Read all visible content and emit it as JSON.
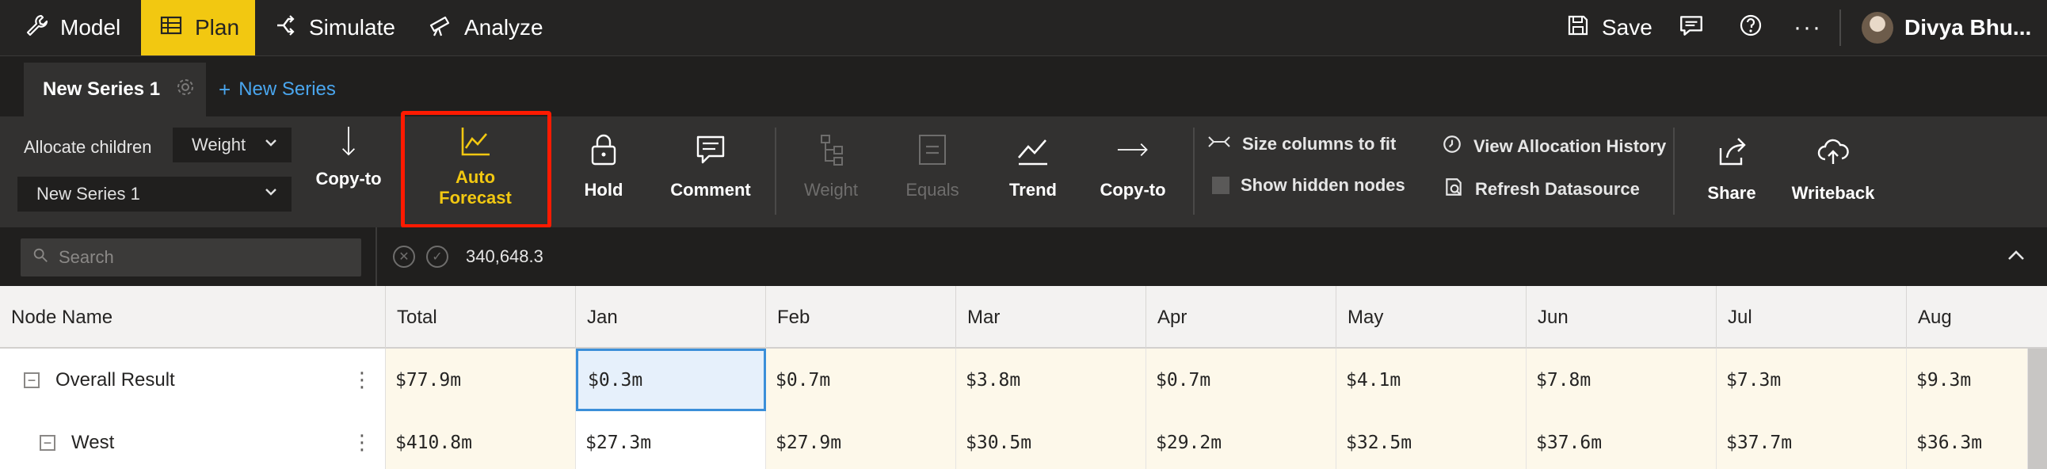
{
  "menu": {
    "items": [
      {
        "label": "Model",
        "icon": "wrench-icon"
      },
      {
        "label": "Plan",
        "icon": "table-icon"
      },
      {
        "label": "Simulate",
        "icon": "branch-icon"
      },
      {
        "label": "Analyze",
        "icon": "telescope-icon"
      }
    ],
    "save_label": "Save",
    "more_label": "···",
    "user_name": "Divya Bhu..."
  },
  "tabs": {
    "active_label": "New Series 1",
    "new_label": "New Series"
  },
  "ribbon": {
    "allocate_label": "Allocate children",
    "allocate_value": "Weight",
    "series_value": "New Series 1",
    "copy_to_1": "Copy-to",
    "auto_forecast_line1": "Auto",
    "auto_forecast_line2": "Forecast",
    "hold": "Hold",
    "comment": "Comment",
    "weight": "Weight",
    "equals": "Equals",
    "trend": "Trend",
    "copy_to_2": "Copy-to",
    "size_columns": "Size columns to fit",
    "show_hidden": "Show hidden nodes",
    "view_history": "View Allocation History",
    "refresh_datasource": "Refresh Datasource",
    "share": "Share",
    "writeback": "Writeback",
    "highlight_color": "#ff1a00",
    "accent_color": "#f2c811"
  },
  "searchbar": {
    "placeholder": "Search",
    "formula_value": "340,648.3"
  },
  "grid": {
    "columns": [
      "Node Name",
      "Total",
      "Jan",
      "Feb",
      "Mar",
      "Apr",
      "May",
      "Jun",
      "Jul",
      "Aug"
    ],
    "rows": [
      {
        "name": "Overall Result",
        "toggle": "−",
        "values": [
          "$77.9m",
          "$0.3m",
          "$0.7m",
          "$3.8m",
          "$0.7m",
          "$4.1m",
          "$7.8m",
          "$7.3m",
          "$9.3m"
        ]
      },
      {
        "name": "West",
        "toggle": "−",
        "values": [
          "$410.8m",
          "$27.3m",
          "$27.9m",
          "$30.5m",
          "$29.2m",
          "$32.5m",
          "$37.6m",
          "$37.7m",
          "$36.3m"
        ]
      }
    ]
  }
}
